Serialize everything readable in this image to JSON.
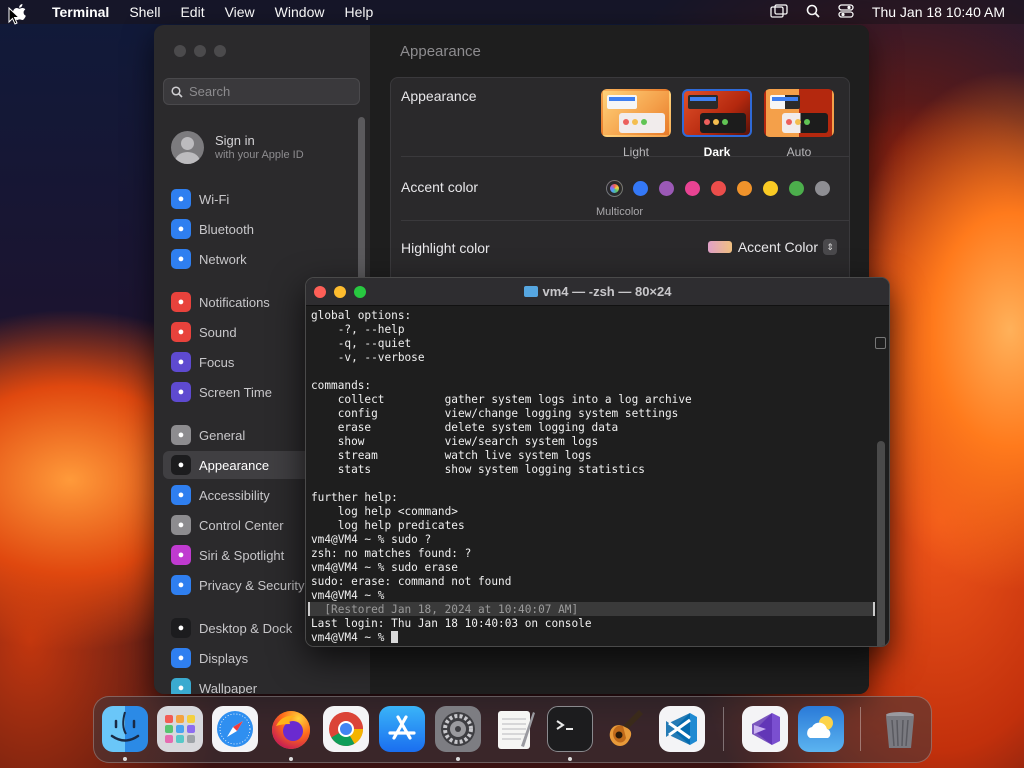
{
  "menubar": {
    "app": "Terminal",
    "items": [
      "Shell",
      "Edit",
      "View",
      "Window",
      "Help"
    ],
    "datetime": "Thu Jan 18  10:40 AM"
  },
  "settings": {
    "search_placeholder": "Search",
    "signin_title": "Sign in",
    "signin_subtitle": "with your Apple ID",
    "sidebar": [
      {
        "label": "Wi-Fi",
        "icon": "wifi-icon",
        "color": "#2f7ff0"
      },
      {
        "label": "Bluetooth",
        "icon": "bluetooth-icon",
        "color": "#2f7ff0"
      },
      {
        "label": "Network",
        "icon": "network-icon",
        "color": "#2f7ff0"
      },
      {
        "label": "Notifications",
        "icon": "notifications-icon",
        "color": "#e8423c"
      },
      {
        "label": "Sound",
        "icon": "sound-icon",
        "color": "#e8423c"
      },
      {
        "label": "Focus",
        "icon": "focus-icon",
        "color": "#5e4ad0"
      },
      {
        "label": "Screen Time",
        "icon": "screen-time-icon",
        "color": "#5e4ad0"
      },
      {
        "label": "General",
        "icon": "general-icon",
        "color": "#8d8c8f"
      },
      {
        "label": "Appearance",
        "icon": "appearance-icon",
        "color": "#1c1c1e"
      },
      {
        "label": "Accessibility",
        "icon": "accessibility-icon",
        "color": "#2f7ff0"
      },
      {
        "label": "Control Center",
        "icon": "control-center-icon",
        "color": "#8d8c8f"
      },
      {
        "label": "Siri & Spotlight",
        "icon": "siri-icon",
        "color": "#c03ad0"
      },
      {
        "label": "Privacy & Security",
        "icon": "privacy-icon",
        "color": "#2f7ff0"
      },
      {
        "label": "Desktop & Dock",
        "icon": "desktop-dock-icon",
        "color": "#1c1c1e"
      },
      {
        "label": "Displays",
        "icon": "displays-icon",
        "color": "#2f7ff0"
      },
      {
        "label": "Wallpaper",
        "icon": "wallpaper-icon",
        "color": "#3aaad0"
      }
    ],
    "selected": "Appearance",
    "page_title": "Appearance",
    "appearance_label": "Appearance",
    "themes": [
      "Light",
      "Dark",
      "Auto"
    ],
    "selected_theme": "Dark",
    "accent_label": "Accent color",
    "accent_colors": [
      "multicolor",
      "#3478f6",
      "#9b59b6",
      "#e84393",
      "#eb4d4b",
      "#f0932b",
      "#f9ca24",
      "#4cae4c",
      "#8e8e93"
    ],
    "accent_caption": "Multicolor",
    "highlight_label": "Highlight color",
    "highlight_value": "Accent Color"
  },
  "terminal": {
    "title": "vm4 — -zsh — 80×24",
    "lines": [
      "global options:",
      "    -?, --help",
      "    -q, --quiet",
      "    -v, --verbose",
      "",
      "commands:",
      "    collect         gather system logs into a log archive",
      "    config          view/change logging system settings",
      "    erase           delete system logging data",
      "    show            view/search system logs",
      "    stream          watch live system logs",
      "    stats           show system logging statistics",
      "",
      "further help:",
      "    log help <command>",
      "    log help predicates",
      "vm4@VM4 ~ % sudo ?",
      "zsh: no matches found: ?",
      "vm4@VM4 ~ % sudo erase",
      "sudo: erase: command not found",
      "vm4@VM4 ~ % ",
      "  [Restored Jan 18, 2024 at 10:40:07 AM]",
      "Last login: Thu Jan 18 10:40:03 on console",
      "vm4@VM4 ~ % "
    ]
  },
  "dock": {
    "apps": [
      "Finder",
      "Launchpad",
      "Safari",
      "Firefox",
      "Google Chrome",
      "App Store",
      "System Settings",
      "TextEdit",
      "Terminal",
      "GarageBand",
      "Visual Studio Code",
      "Visual Studio",
      "Weather",
      "Trash"
    ]
  }
}
